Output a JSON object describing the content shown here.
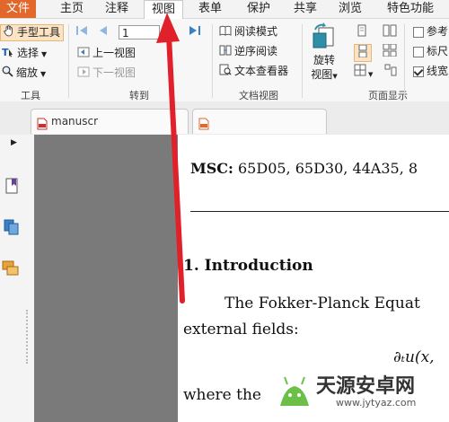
{
  "menu": {
    "tabs": [
      {
        "label": "文件"
      },
      {
        "label": "主页"
      },
      {
        "label": "注释"
      },
      {
        "label": "视图"
      },
      {
        "label": "表单"
      },
      {
        "label": "保护"
      },
      {
        "label": "共享"
      },
      {
        "label": "浏览"
      },
      {
        "label": "特色功能"
      }
    ],
    "active_tab": "视图",
    "accent_color": "#e2672a"
  },
  "ribbon": {
    "tools": {
      "hand_tool": "手型工具",
      "select": "选择",
      "zoom": "缩放",
      "group_label": "工具"
    },
    "goto": {
      "page_value": "1",
      "prev_view": "上一视图",
      "next_view": "下一视图",
      "group_label": "转到"
    },
    "docview": {
      "reading_mode": "阅读模式",
      "reverse_reading": "逆序阅读",
      "text_viewer": "文本查看器",
      "group_label": "文档视图"
    },
    "pagedisplay": {
      "rotate_view_line1": "旋转",
      "rotate_view_line2": "视图",
      "group_label": "页面显示"
    },
    "options": {
      "reference": "参考",
      "ruler": "标尺",
      "lineweight": "线宽",
      "lineweight_checked": true
    }
  },
  "tabs": {
    "doc_tab_label": "manuscr"
  },
  "document": {
    "msc_label": "MSC:",
    "msc_codes": "65D05, 65D30, 44A35, 8",
    "section_heading": "1. Introduction",
    "para_line1": "The Fokker-Planck Equat",
    "para_line2": "external fields:",
    "formula": "∂ₜu(x,",
    "para_line3": "where the"
  },
  "watermark": {
    "name": "天源安卓网",
    "url": "www.jytyaz.com"
  },
  "annotation": {
    "arrow_color": "#e0202a"
  }
}
